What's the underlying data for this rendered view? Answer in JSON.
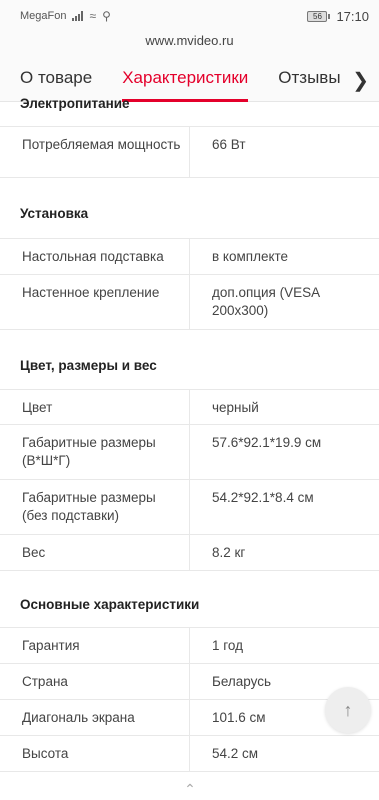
{
  "statusbar": {
    "carrier": "MegaFon",
    "battery": "56",
    "time": "17:10"
  },
  "browser": {
    "url": "www.mvideo.ru"
  },
  "tabs": [
    {
      "label": "О товаре"
    },
    {
      "label": "Характеристики"
    },
    {
      "label": "Отзывы"
    }
  ],
  "sections": [
    {
      "title": "Электропитание",
      "rows": [
        {
          "key": "Потребляемая мощность",
          "value": "66 Вт"
        }
      ]
    },
    {
      "title": "Установка",
      "rows": [
        {
          "key": "Настольная подставка",
          "value": "в комплекте"
        },
        {
          "key": "Настенное крепление",
          "value": "доп.опция (VESA 200x300)"
        }
      ]
    },
    {
      "title": "Цвет, размеры и вес",
      "rows": [
        {
          "key": "Цвет",
          "value": "черный"
        },
        {
          "key": "Габаритные размеры (В*Ш*Г)",
          "value": "57.6*92.1*19.9 см"
        },
        {
          "key": "Габаритные размеры (без подставки)",
          "value": "54.2*92.1*8.4 см"
        },
        {
          "key": "Вес",
          "value": "8.2 кг"
        }
      ]
    },
    {
      "title": "Основные характеристики",
      "rows": [
        {
          "key": "Гарантия",
          "value": "1 год"
        },
        {
          "key": "Страна",
          "value": "Беларусь"
        },
        {
          "key": "Диагональ экрана",
          "value": "101.6 см"
        },
        {
          "key": "Высота",
          "value": "54.2 см"
        }
      ]
    }
  ],
  "colors": {
    "accent": "#e4002b"
  },
  "icons": {
    "scroll_up": "arrow-up-icon",
    "more_tabs": "chevron-right-icon"
  }
}
